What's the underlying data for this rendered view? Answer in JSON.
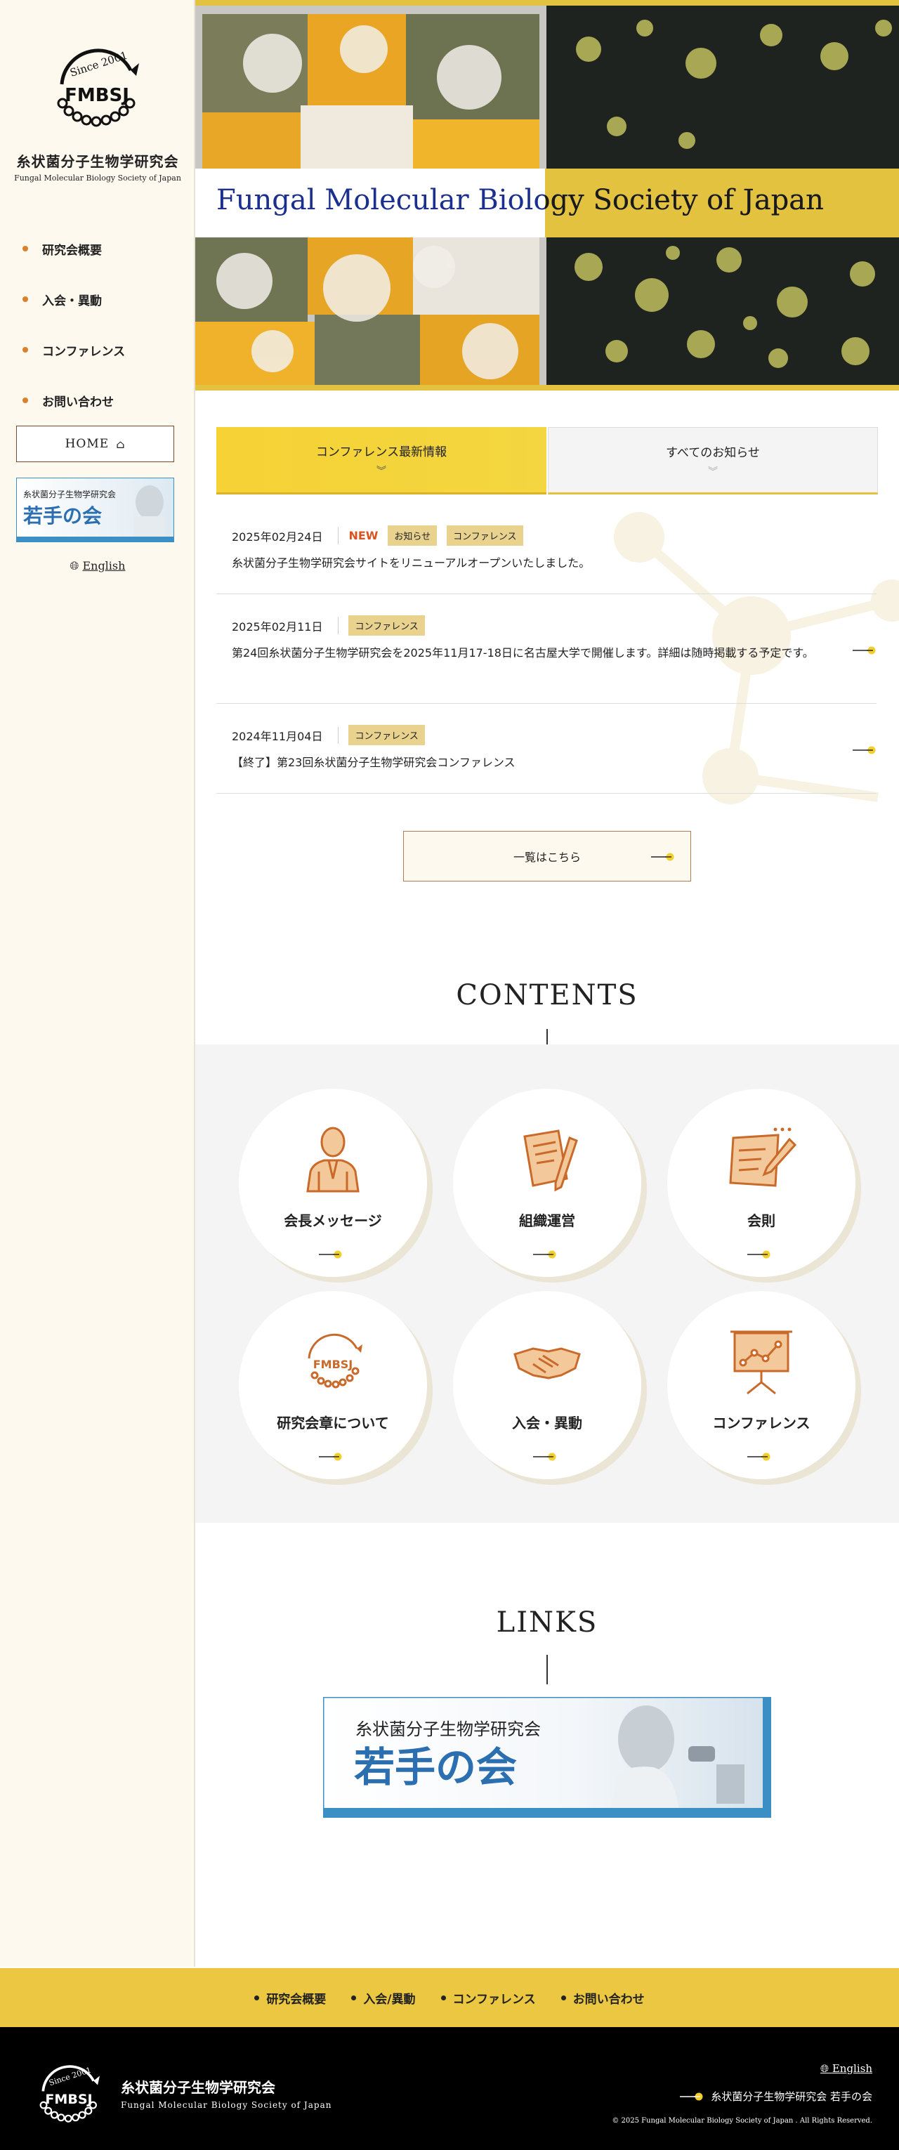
{
  "site": {
    "title": "糸状菌分子生物学研究会",
    "subtitle": "Fungal Molecular Biology Society of Japan",
    "logo_text": "FMBSJ",
    "logo_since": "Since 2001"
  },
  "sidebar": {
    "nav": [
      {
        "label": "研究会概要"
      },
      {
        "label": "入会・異動"
      },
      {
        "label": "コンファレンス"
      },
      {
        "label": "お問い合わせ"
      }
    ],
    "home_label": "HOME",
    "banner": {
      "line1": "糸状菌分子生物学研究会",
      "line2": "若手の会"
    },
    "english_label": "English"
  },
  "hero": {
    "title": "Fungal Molecular Biology Society of Japan"
  },
  "tabs": [
    {
      "label": "コンファレンス最新情報",
      "active": true
    },
    {
      "label": "すべてのお知らせ",
      "active": false
    }
  ],
  "news": [
    {
      "date": "2025年02月24日",
      "new_label": "NEW",
      "tags": [
        "お知らせ",
        "コンファレンス"
      ],
      "text": "糸状菌分子生物学研究会サイトをリニューアルオープンいたしました。"
    },
    {
      "date": "2025年02月11日",
      "tags": [
        "コンファレンス"
      ],
      "text": "第24回糸状菌分子生物学研究会を2025年11月17-18日に名古屋大学で開催します。詳細は随時掲載する予定です。"
    },
    {
      "date": "2024年11月04日",
      "tags": [
        "コンファレンス"
      ],
      "text": "【終了】第23回糸状菌分子生物学研究会コンファレンス"
    }
  ],
  "more_label": "一覧はこちら",
  "contents": {
    "title": "CONTENTS",
    "items": [
      {
        "label": "会長メッセージ",
        "icon": "president-icon"
      },
      {
        "label": "組織運営",
        "icon": "document-pen-icon"
      },
      {
        "label": "会則",
        "icon": "rules-icon"
      },
      {
        "label": "研究会章について",
        "icon": "emblem-icon"
      },
      {
        "label": "入会・異動",
        "icon": "handshake-icon"
      },
      {
        "label": "コンファレンス",
        "icon": "presentation-icon"
      }
    ]
  },
  "links": {
    "title": "LINKS",
    "banner": {
      "line1": "糸状菌分子生物学研究会",
      "line2": "若手の会"
    }
  },
  "footer": {
    "nav": [
      {
        "label": "研究会概要"
      },
      {
        "label": "入会/異動"
      },
      {
        "label": "コンファレンス"
      },
      {
        "label": "お問い合わせ"
      }
    ],
    "title": "糸状菌分子生物学研究会",
    "subtitle": "Fungal Molecular Biology Society of Japan",
    "english_label": "English",
    "link_label": "糸状菌分子生物学研究会 若手の会",
    "copyright": "© 2025 Fungal Molecular Biology Society of Japan . All Rights Reserved."
  },
  "colors": {
    "accent": "#e2c23e",
    "orange": "#c96a2a",
    "navy": "#1b2f8f"
  }
}
